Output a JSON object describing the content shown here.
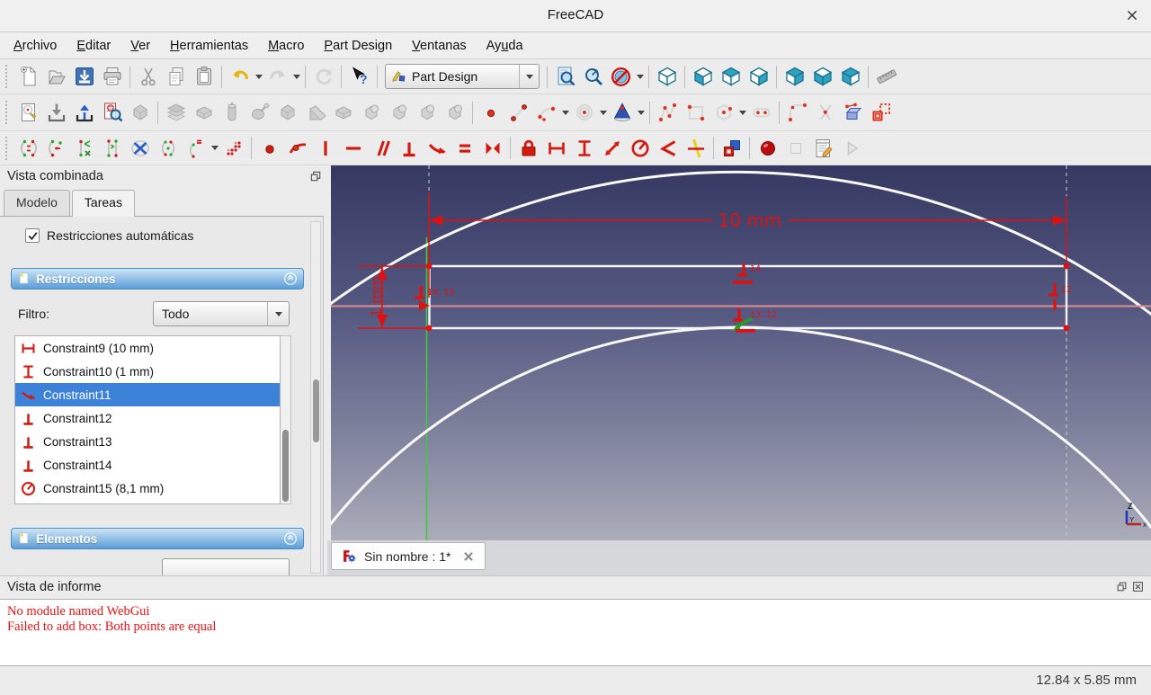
{
  "window": {
    "title": "FreeCAD"
  },
  "colors": {
    "accent_blue": "#3c82d8",
    "constraint_red": "#e01010",
    "error_red": "#ee1111",
    "axis_green": "#3fca3f",
    "sketch_axis_salmon": "#e58d8d",
    "section_header_blue": "#5b9ed8",
    "viewport_top": "#353860",
    "viewport_bottom": "#abadba"
  },
  "menu": {
    "items": [
      {
        "label": "Archivo",
        "u": 0
      },
      {
        "label": "Editar",
        "u": 0
      },
      {
        "label": "Ver",
        "u": 0
      },
      {
        "label": "Herramientas",
        "u": 0
      },
      {
        "label": "Macro",
        "u": 0
      },
      {
        "label": "Part Design",
        "u": 0
      },
      {
        "label": "Ventanas",
        "u": 0
      },
      {
        "label": "Ayuda",
        "u": 2
      }
    ]
  },
  "toolbars": {
    "workbench_value": "Part Design",
    "standard": [
      "H",
      {
        "i": "new",
        "n": "new-file"
      },
      {
        "i": "open",
        "n": "open-file"
      },
      {
        "i": "save",
        "n": "save-file"
      },
      {
        "i": "print",
        "n": "print"
      },
      "|",
      {
        "i": "cut",
        "n": "cut"
      },
      {
        "i": "copy",
        "n": "copy"
      },
      {
        "i": "paste",
        "n": "paste"
      },
      "|",
      {
        "i": "undo",
        "n": "undo",
        "c": 1
      },
      {
        "i": "redo",
        "n": "redo",
        "c": 1,
        "d": 1
      },
      "|",
      {
        "i": "refresh",
        "n": "refresh",
        "d": 1
      },
      "|",
      {
        "i": "whatsthis",
        "n": "whats-this"
      },
      "|",
      {
        "combo": 1,
        "i": "wb",
        "n": "workbench-selector"
      },
      "|",
      {
        "i": "fitall",
        "n": "fit-all"
      },
      {
        "i": "zoomsel",
        "n": "box-zoom"
      },
      {
        "i": "drawstyle",
        "n": "draw-style",
        "c": 1
      },
      "|",
      {
        "i": "cubeA",
        "n": "view-axonometric"
      },
      "|",
      {
        "i": "cubeF",
        "n": "view-front"
      },
      {
        "i": "cubeT",
        "n": "view-top"
      },
      {
        "i": "cubeR",
        "n": "view-right"
      },
      "|",
      {
        "i": "cubeRe",
        "n": "view-rear"
      },
      {
        "i": "cubeB",
        "n": "view-bottom"
      },
      {
        "i": "cubeL",
        "n": "view-left"
      },
      "|",
      {
        "i": "ruler",
        "n": "measure-distance"
      }
    ],
    "sketch": [
      "H",
      {
        "i": "sketchnew",
        "n": "create-sketch"
      },
      {
        "i": "importsk",
        "n": "leave-sketch"
      },
      {
        "i": "exportsk",
        "n": "view-sketch"
      },
      {
        "i": "viewsketch",
        "n": "view-section"
      },
      {
        "i": "gcube",
        "n": "map-sketch",
        "d": 1
      },
      "|",
      {
        "i": "gpad",
        "n": "pad",
        "d": 1
      },
      {
        "i": "gbox",
        "n": "pocket",
        "d": 1
      },
      {
        "i": "grev",
        "n": "revolution",
        "d": 1
      },
      {
        "i": "gpin",
        "n": "groove",
        "d": 1
      },
      {
        "i": "gcube",
        "n": "additive-primitive",
        "d": 1
      },
      {
        "i": "gwedge",
        "n": "subtractive-primitive",
        "d": 1
      },
      {
        "i": "gbox",
        "n": "boolean-operation",
        "d": 1
      },
      {
        "i": "gbool",
        "n": "fillet-feature",
        "d": 1
      },
      {
        "i": "gbool",
        "n": "linear-pattern",
        "d": 1
      },
      {
        "i": "gbool",
        "n": "mirrored-feature",
        "d": 1
      },
      {
        "i": "gbool",
        "n": "polar-pattern",
        "d": 1
      },
      "|",
      {
        "i": "point",
        "n": "create-point"
      },
      {
        "i": "line",
        "n": "create-line"
      },
      {
        "i": "arc",
        "n": "create-arc",
        "c": 1
      },
      {
        "i": "circle",
        "n": "create-circle",
        "c": 1
      },
      {
        "i": "conics",
        "n": "create-conic",
        "c": 1
      },
      "|",
      {
        "i": "polyline",
        "n": "create-polyline"
      },
      {
        "i": "rect",
        "n": "create-rectangle"
      },
      {
        "i": "polygon",
        "n": "create-polygon",
        "c": 1
      },
      {
        "i": "slot",
        "n": "create-slot"
      },
      "|",
      {
        "i": "filletsk",
        "n": "create-fillet"
      },
      {
        "i": "trim",
        "n": "trim-edge"
      },
      {
        "i": "external",
        "n": "external-geometry"
      },
      {
        "i": "carbon",
        "n": "carbon-copy"
      }
    ],
    "constraints": [
      "H",
      {
        "i": "skA",
        "n": "sketcher-clone"
      },
      {
        "i": "skB",
        "n": "sketcher-move"
      },
      {
        "i": "skC",
        "n": "sketcher-trim-tools"
      },
      {
        "i": "skD",
        "n": "sketcher-extend-tools"
      },
      {
        "i": "hideint",
        "n": "hide-internal-geometry"
      },
      {
        "i": "skE",
        "n": "show-internal-geometry"
      },
      {
        "i": "skF",
        "n": "switch-virtual-space",
        "c": 1
      },
      {
        "i": "dotsgrid",
        "n": "rectangular-array"
      },
      "|",
      {
        "i": "c-coincident",
        "n": "constrain-coincident"
      },
      {
        "i": "c-pointonobj",
        "n": "constrain-point-on-object"
      },
      {
        "i": "c-vertical",
        "n": "constrain-vertical"
      },
      {
        "i": "c-horizontal",
        "n": "constrain-horizontal"
      },
      {
        "i": "c-parallel",
        "n": "constrain-parallel"
      },
      {
        "i": "c-perp",
        "n": "constrain-perpendicular"
      },
      {
        "i": "c-tangent",
        "n": "constrain-tangent"
      },
      {
        "i": "c-equal",
        "n": "constrain-equal"
      },
      {
        "i": "c-symmetric",
        "n": "constrain-symmetric"
      },
      "|",
      {
        "i": "c-lock",
        "n": "constrain-lock"
      },
      {
        "i": "c-hdist",
        "n": "constrain-horizontal-distance"
      },
      {
        "i": "c-vdist",
        "n": "constrain-vertical-distance"
      },
      {
        "i": "c-dist",
        "n": "constrain-distance"
      },
      {
        "i": "c-radius",
        "n": "constrain-radius"
      },
      {
        "i": "c-angle",
        "n": "constrain-angle"
      },
      {
        "i": "c-snell",
        "n": "constrain-snells-law"
      },
      "|",
      {
        "i": "c-toggle",
        "n": "toggle-driving-constraint"
      },
      "|",
      {
        "i": "record",
        "n": "macro-record"
      },
      {
        "i": "stopg",
        "n": "macro-stop",
        "d": 1
      },
      {
        "i": "macroedit",
        "n": "macro-edit"
      },
      {
        "i": "playg",
        "n": "macro-execute",
        "d": 1
      }
    ]
  },
  "combined_view": {
    "title": "Vista combinada",
    "tab_model": "Modelo",
    "tab_tasks": "Tareas",
    "auto_constraints": "Restricciones automáticas",
    "constraints_title": "Restricciones",
    "filter_label": "Filtro:",
    "filter_value": "Todo",
    "constraints": [
      {
        "icon": "c-hdist",
        "label": "Constraint9 (10 mm)"
      },
      {
        "icon": "c-vdist",
        "label": "Constraint10 (1 mm)"
      },
      {
        "icon": "c-tangent",
        "label": "Constraint11",
        "selected": true
      },
      {
        "icon": "c-perp",
        "label": "Constraint12"
      },
      {
        "icon": "c-perp",
        "label": "Constraint13"
      },
      {
        "icon": "c-perp",
        "label": "Constraint14"
      },
      {
        "icon": "c-radius",
        "label": "Constraint15 (8,1 mm)"
      }
    ],
    "elements_title": "Elementos"
  },
  "viewport": {
    "dim_width": "10 mm",
    "dim_height": "1 mm",
    "markers": {
      "left": "14, 13",
      "top": "14",
      "bottom": "13, 12",
      "right": "12"
    },
    "axis": {
      "z": "Z",
      "y": "Y",
      "x": "x"
    }
  },
  "document_tab": {
    "label": "Sin nombre : 1*"
  },
  "report": {
    "title": "Vista de informe",
    "lines": [
      "No module named WebGui",
      "Failed to add box: Both points are equal"
    ]
  },
  "statusbar": {
    "value": "12.84 x 5.85 mm"
  }
}
